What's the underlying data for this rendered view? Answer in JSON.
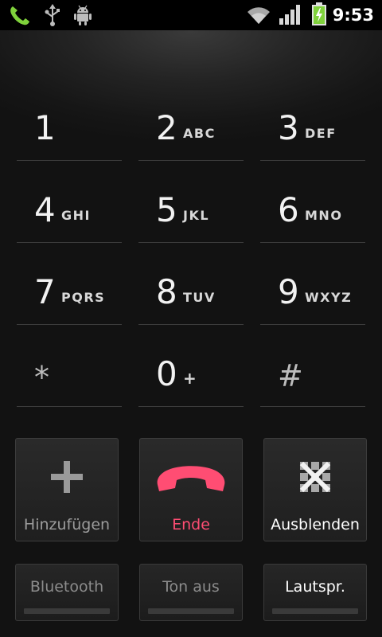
{
  "status_bar": {
    "time": "9:53",
    "icons": [
      "phone-call-icon",
      "usb-icon",
      "android-debug-icon",
      "wifi-icon",
      "signal-icon",
      "battery-charging-icon"
    ],
    "accent_color": "#7fd13b"
  },
  "dialpad": {
    "keys": [
      {
        "digit": "1",
        "letters": ""
      },
      {
        "digit": "2",
        "letters": "ABC"
      },
      {
        "digit": "3",
        "letters": "DEF"
      },
      {
        "digit": "4",
        "letters": "GHI"
      },
      {
        "digit": "5",
        "letters": "JKL"
      },
      {
        "digit": "6",
        "letters": "MNO"
      },
      {
        "digit": "7",
        "letters": "PQRS"
      },
      {
        "digit": "8",
        "letters": "TUV"
      },
      {
        "digit": "9",
        "letters": "WXYZ"
      },
      {
        "digit": "*",
        "letters": ""
      },
      {
        "digit": "0",
        "letters": "+"
      },
      {
        "digit": "#",
        "letters": ""
      }
    ]
  },
  "call_controls": {
    "add_label": "Hinzufügen",
    "end_label": "Ende",
    "hide_label": "Ausblenden",
    "end_color": "#ff4d73",
    "icons": {
      "add": "plus-icon",
      "end": "end-call-icon",
      "hide": "hide-dialpad-icon"
    }
  },
  "toggles": {
    "bluetooth_label": "Bluetooth",
    "mute_label": "Ton aus",
    "speaker_label": "Lautspr."
  }
}
